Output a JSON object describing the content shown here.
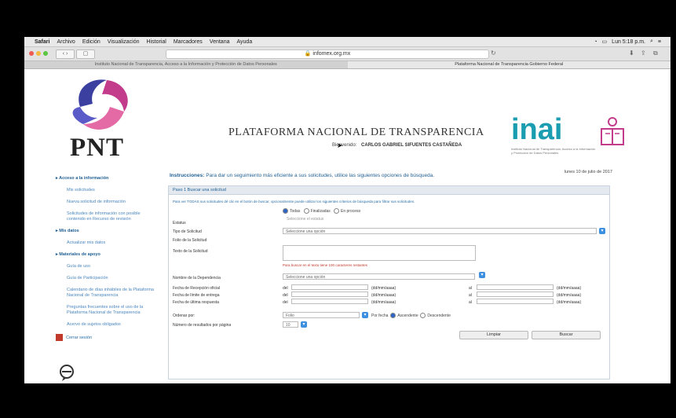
{
  "menubar": {
    "apple": "",
    "items": [
      "Safari",
      "Archivo",
      "Edición",
      "Visualización",
      "Historial",
      "Marcadores",
      "Ventana",
      "Ayuda"
    ],
    "clock": "Lun 5:18 p.m."
  },
  "toolbar": {
    "url": "infomex.org.mx"
  },
  "tabs": [
    {
      "label": "Instituto Nacional de Transparencia, Acceso a la Información y Protección de Datos Personales",
      "active": false
    },
    {
      "label": "Plataforma Nacional de Transparencia Gobierno Federal",
      "active": true
    }
  ],
  "header": {
    "pnt": "PNT",
    "title": "PLATAFORMA NACIONAL DE TRANSPARENCIA",
    "welcome_label": "Bienvenido:",
    "user": "CARLOS GABRIEL SIFUENTES CASTAÑEDA",
    "inai": "inai",
    "inai_sub": "Instituto Nacional de Transparencia, Acceso a la Información y Protección de Datos Personales"
  },
  "date": "lunes 10 de julio de 2017",
  "sidebar": [
    {
      "label": "Acceso a la información",
      "type": "head"
    },
    {
      "label": "Mis solicitudes",
      "type": "sub"
    },
    {
      "label": "Nueva solicitud de información",
      "type": "sub"
    },
    {
      "label": "Solicitudes de información con posible contenido en Recurso de revisión",
      "type": "sub"
    },
    {
      "label": "Mis datos",
      "type": "head"
    },
    {
      "label": "Actualizar mis datos",
      "type": "sub"
    },
    {
      "label": "Materiales de apoyo",
      "type": "head"
    },
    {
      "label": "Guía de uso",
      "type": "sub"
    },
    {
      "label": "Guía de Participación",
      "type": "sub"
    },
    {
      "label": "Calendario de días inhábiles de la Plataforma Nacional de Transparencia",
      "type": "sub"
    },
    {
      "label": "Preguntas frecuentes sobre el uso de la Plataforma Nacional de Transparencia",
      "type": "sub"
    },
    {
      "label": "Acervo de sujetos obligados",
      "type": "sub"
    },
    {
      "label": "Cerrar sesión",
      "type": "icon"
    }
  ],
  "main": {
    "instructions_bold": "Instrucciones:",
    "instructions": "Para dar un seguimiento más eficiente a sus solicitudes, utilice las siguientes opciones de búsqueda.",
    "panel_title": "Paso 1 Buscar una solicitud",
    "panel_desc": "Para ver TODAS sus solicitudes dé clic en el botón de buscar, opcionalmente puede utilizar los siguientes criterios de búsqueda para filtrar sus solicitudes.",
    "filter_options": [
      "Todas",
      "Finalizadas",
      "En proceso"
    ],
    "labels": {
      "estatus": "Estatus",
      "tipo": "Tipo de Solicitud",
      "folio": "Folio de la Solicitud",
      "texto": "Texto de la Solicitud",
      "sujeto": "Nombre de la Dependencia",
      "fecha_oficial": "Fecha de Recepción oficial",
      "fecha_limite": "Fecha de límite de entrega",
      "fecha_ultima": "Fecha de última respuesta",
      "ordenar": "Ordenar por:",
      "numero": "Número de resultados por página"
    },
    "select_placeholder": "Seleccione una opción",
    "estatus_placeholder": "Seleccione el estatus",
    "text_note": "Para buscar en el texto tiene 100 caracteres restantes",
    "del": "del",
    "al": "al",
    "date_format": "(dd/mm/aaaa)",
    "ordenar_value": "Folio",
    "sort_options": [
      "Por fecha",
      "Ascendente",
      "Descendente"
    ],
    "per_page": "10",
    "btn_clear": "Limpiar",
    "btn_search": "Buscar"
  }
}
